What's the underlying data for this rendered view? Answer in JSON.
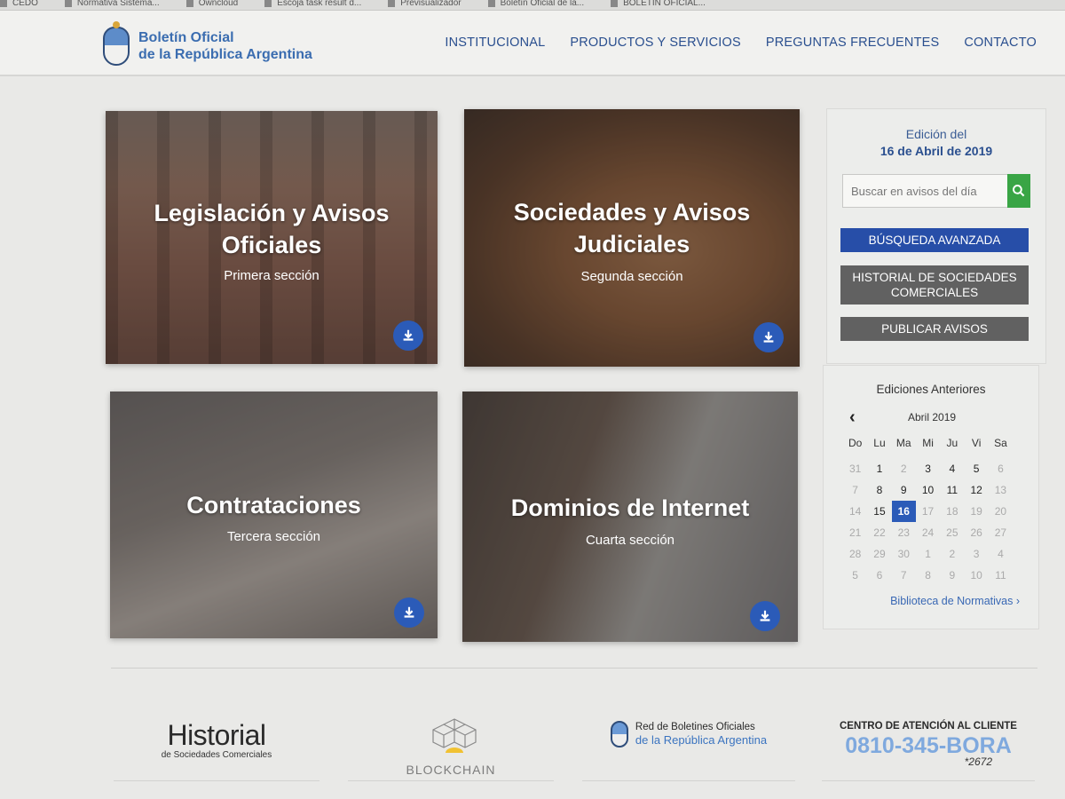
{
  "bookmarks": [
    "CEDO",
    "Normativa Sistema...",
    "Owncloud",
    "Escoja task result d...",
    "Previsualizador",
    "Boletín Oficial de la...",
    "BOLETÍN OFICIAL..."
  ],
  "header": {
    "logo_line1": "Boletín Oficial",
    "logo_line2": "de la República Argentina",
    "nav": [
      "INSTITUCIONAL",
      "PRODUCTOS Y SERVICIOS",
      "PREGUNTAS FRECUENTES",
      "CONTACTO"
    ]
  },
  "tiles": [
    {
      "title": "Legislación y Avisos Oficiales",
      "subtitle": "Primera sección"
    },
    {
      "title": "Sociedades y Avisos Judiciales",
      "subtitle": "Segunda sección"
    },
    {
      "title": "Contrataciones",
      "subtitle": "Tercera sección"
    },
    {
      "title": "Dominios de Internet",
      "subtitle": "Cuarta sección"
    }
  ],
  "sidebar": {
    "edition_label": "Edición del",
    "edition_date": "16 de Abril de 2019",
    "search_placeholder": "Buscar en avisos del día",
    "btn_advanced": "BÚSQUEDA AVANZADA",
    "btn_history": "HISTORIAL DE SOCIEDADES COMERCIALES",
    "btn_publish": "PUBLICAR AVISOS"
  },
  "calendar": {
    "title": "Ediciones Anteriores",
    "prev_icon": "chevron-left-icon",
    "month": "Abril 2019",
    "weekdays": [
      "Do",
      "Lu",
      "Ma",
      "Mi",
      "Ju",
      "Vi",
      "Sa"
    ],
    "days": [
      [
        "31",
        "m"
      ],
      [
        "1",
        ""
      ],
      [
        "2",
        "m"
      ],
      [
        "3",
        ""
      ],
      [
        "4",
        ""
      ],
      [
        "5",
        ""
      ],
      [
        "6",
        "m"
      ],
      [
        "7",
        "m"
      ],
      [
        "8",
        ""
      ],
      [
        "9",
        ""
      ],
      [
        "10",
        ""
      ],
      [
        "11",
        ""
      ],
      [
        "12",
        ""
      ],
      [
        "13",
        "m"
      ],
      [
        "14",
        "m"
      ],
      [
        "15",
        ""
      ],
      [
        "16",
        "s"
      ],
      [
        "17",
        "m"
      ],
      [
        "18",
        "m"
      ],
      [
        "19",
        "m"
      ],
      [
        "20",
        "m"
      ],
      [
        "21",
        "m"
      ],
      [
        "22",
        "m"
      ],
      [
        "23",
        "m"
      ],
      [
        "24",
        "m"
      ],
      [
        "25",
        "m"
      ],
      [
        "26",
        "m"
      ],
      [
        "27",
        "m"
      ],
      [
        "28",
        "m"
      ],
      [
        "29",
        "m"
      ],
      [
        "30",
        "m"
      ],
      [
        "1",
        "m"
      ],
      [
        "2",
        "m"
      ],
      [
        "3",
        "m"
      ],
      [
        "4",
        "m"
      ],
      [
        "5",
        "m"
      ],
      [
        "6",
        "m"
      ],
      [
        "7",
        "m"
      ],
      [
        "8",
        "m"
      ],
      [
        "9",
        "m"
      ],
      [
        "10",
        "m"
      ],
      [
        "11",
        "m"
      ]
    ],
    "library_link": "Biblioteca de Normativas ›"
  },
  "footer": {
    "historial_big": "Historial",
    "historial_small": "de Sociedades Comerciales",
    "blockchain": "BLOCKCHAIN",
    "red_line1": "Red de Boletines Oficiales",
    "red_line2": "de la República Argentina",
    "cac_title": "CENTRO DE ATENCIÓN AL CLIENTE",
    "cac_number": "0810-345-BORA",
    "cac_ext": "*2672"
  },
  "colors": {
    "brand_blue": "#2a4f8f",
    "button_blue": "#274ea8",
    "search_green": "#39a545",
    "button_gray": "#616161",
    "selected_day": "#2b5bb8"
  }
}
